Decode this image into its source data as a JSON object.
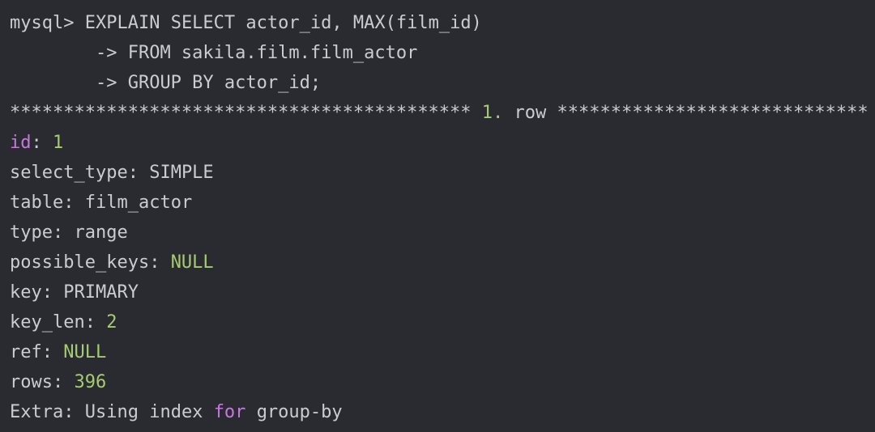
{
  "terminal": {
    "prompt": "mysql>",
    "query": [
      "EXPLAIN SELECT actor_id, MAX(film_id)",
      "-> FROM sakila.film.film_actor",
      "-> GROUP BY actor_id;"
    ],
    "separator": {
      "stars_left": "*******************************************",
      "row_number": "1.",
      "row_word": "row",
      "stars_right": "*****************************"
    },
    "fields": {
      "id": {
        "label": "id",
        "value": "1"
      },
      "select_type": {
        "label": "select_type",
        "value": "SIMPLE"
      },
      "table": {
        "label": "table",
        "value": "film_actor"
      },
      "type": {
        "label": "type",
        "value": "range"
      },
      "possible_keys": {
        "label": "possible_keys",
        "value": "NULL"
      },
      "key": {
        "label": "key",
        "value": "PRIMARY"
      },
      "key_len": {
        "label": "key_len",
        "value": "2"
      },
      "ref": {
        "label": "ref",
        "value": "NULL"
      },
      "rows": {
        "label": "rows",
        "value": "396"
      },
      "extra": {
        "label": "Extra",
        "value_a": "Using index",
        "value_kw": "for",
        "value_b": "group-by"
      }
    }
  },
  "colors": {
    "background": "#292b30",
    "text": "#c9ccd1",
    "number": "#a6cc70",
    "keyword": "#c678dd"
  }
}
